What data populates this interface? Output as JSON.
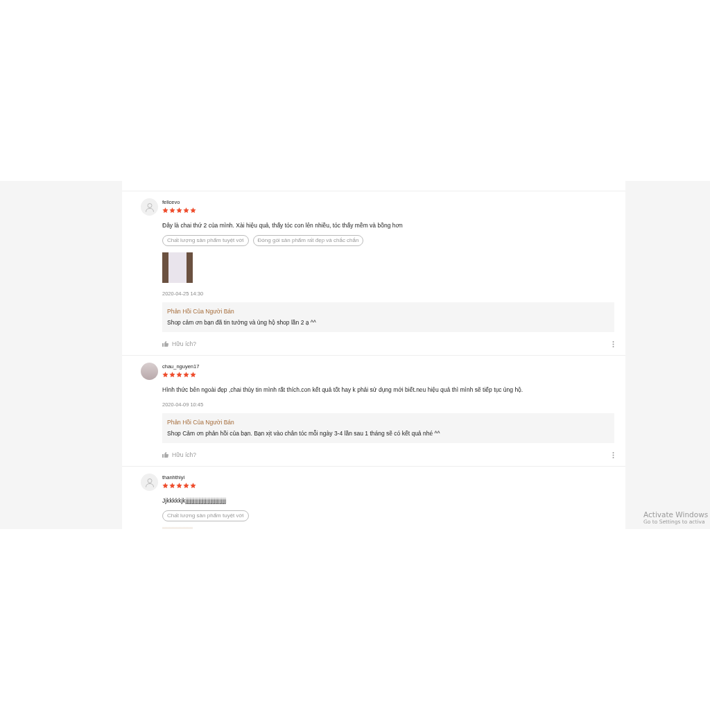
{
  "reviews": [
    {
      "username": "felicevo",
      "avatar": {
        "kind": "default"
      },
      "stars": 5,
      "comment": "Đây là chai thứ 2 của mình. Xài hiệu quả, thấy tóc con lên nhiều, tóc thấy mềm và bồng hơn",
      "tags": [
        "Chất lượng sản phẩm tuyệt vời",
        "Đóng gói sản phẩm rất đẹp và chắc chắn"
      ],
      "has_photo": true,
      "date": "2020-04-25 14:30",
      "seller_reply": {
        "title": "Phản Hồi Của Người Bán",
        "text": "Shop cảm ơn bạn đã tin tưởng và ủng hộ shop lần 2 ạ ^^"
      },
      "helpful": "Hữu ích?"
    },
    {
      "username": "chau_nguyen17",
      "avatar": {
        "kind": "photo"
      },
      "stars": 5,
      "comment": "Hình thức bên ngoài đẹp ,chai thủy tin mình rất thích.con kết quả tốt hay k phải sử dụng mới biết.neu hiệu quả thì mình sẽ tiếp tục ủng hộ.",
      "has_photo": false,
      "date": "2020-04-09 10:45",
      "seller_reply": {
        "title": "Phản Hồi Của Người Bán",
        "text": "Shop Cảm ơn phản hồi của bạn. Bạn xịt vào chân tóc mỗi ngày 3-4 lần sau 1 tháng sẽ có kết quả nhé ^^"
      },
      "helpful": "Hữu ích?"
    },
    {
      "username": "thanhthiyi",
      "avatar": {
        "kind": "default"
      },
      "stars": 5,
      "comment": "Jjkkkkkjkjjjjjjjjjjjjjjjjjjjjjjjjjjjjjjj",
      "tags": [
        "Chất lượng sản phẩm tuyệt vời"
      ],
      "has_photo": true
    }
  ],
  "os_notice": {
    "title": "Activate Windows",
    "text": "Go to Settings to activa"
  }
}
